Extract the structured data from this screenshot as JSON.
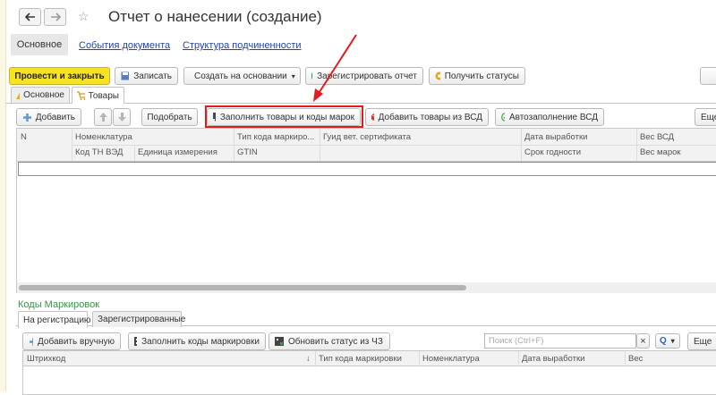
{
  "window": {
    "title": "Отчет о нанесении (создание)"
  },
  "form_tabs": [
    "Основное",
    "События документа",
    "Структура подчиненности"
  ],
  "toolbar": {
    "post_close": "Провести и закрыть",
    "save": "Записать",
    "create_based": "Создать на основании",
    "register_report": "Зарегистрировать отчет",
    "get_statuses": "Получить статусы"
  },
  "page_tabs": [
    "Основное",
    "Товары"
  ],
  "goods_toolbar": {
    "add": "Добавить",
    "pick": "Подобрать",
    "fill_goods_codes": "Заполнить товары и коды марок",
    "add_from_vsd": "Добавить товары из ВСД",
    "auto_vsd": "Автозаполнение ВСД",
    "more": "Еще"
  },
  "goods_table": {
    "header_row1": [
      "N",
      "Номенклатура",
      "Тип кода маркиро...",
      "Гуид вет. сертификата",
      "Дата выработки",
      "Вес ВСД"
    ],
    "header_row2": [
      "Код ТН ВЭД",
      "Единица измерения",
      "GTIN",
      "Срок годности",
      "Вес марок"
    ]
  },
  "codes_section": {
    "title": "Коды Маркировок",
    "tabs": [
      "На регистрацию",
      "Зарегистрированные"
    ],
    "add_manual": "Добавить вручную",
    "fill_codes": "Заполнить коды маркировки",
    "update_status": "Обновить статус из ЧЗ",
    "search_placeholder": "Поиск (Ctrl+F)",
    "clear_search": "×",
    "search_icon": "Q",
    "more": "Еще",
    "columns": [
      "Штрихкод",
      "↓",
      "Тип кода маркировки",
      "Номенклатура",
      "Дата выработки",
      "Вес"
    ]
  },
  "colors": {
    "accent_yellow": "#f7e324",
    "highlight_red": "#e31b1b",
    "link_blue": "#1d44b3",
    "section_green": "#2d9a3e"
  }
}
